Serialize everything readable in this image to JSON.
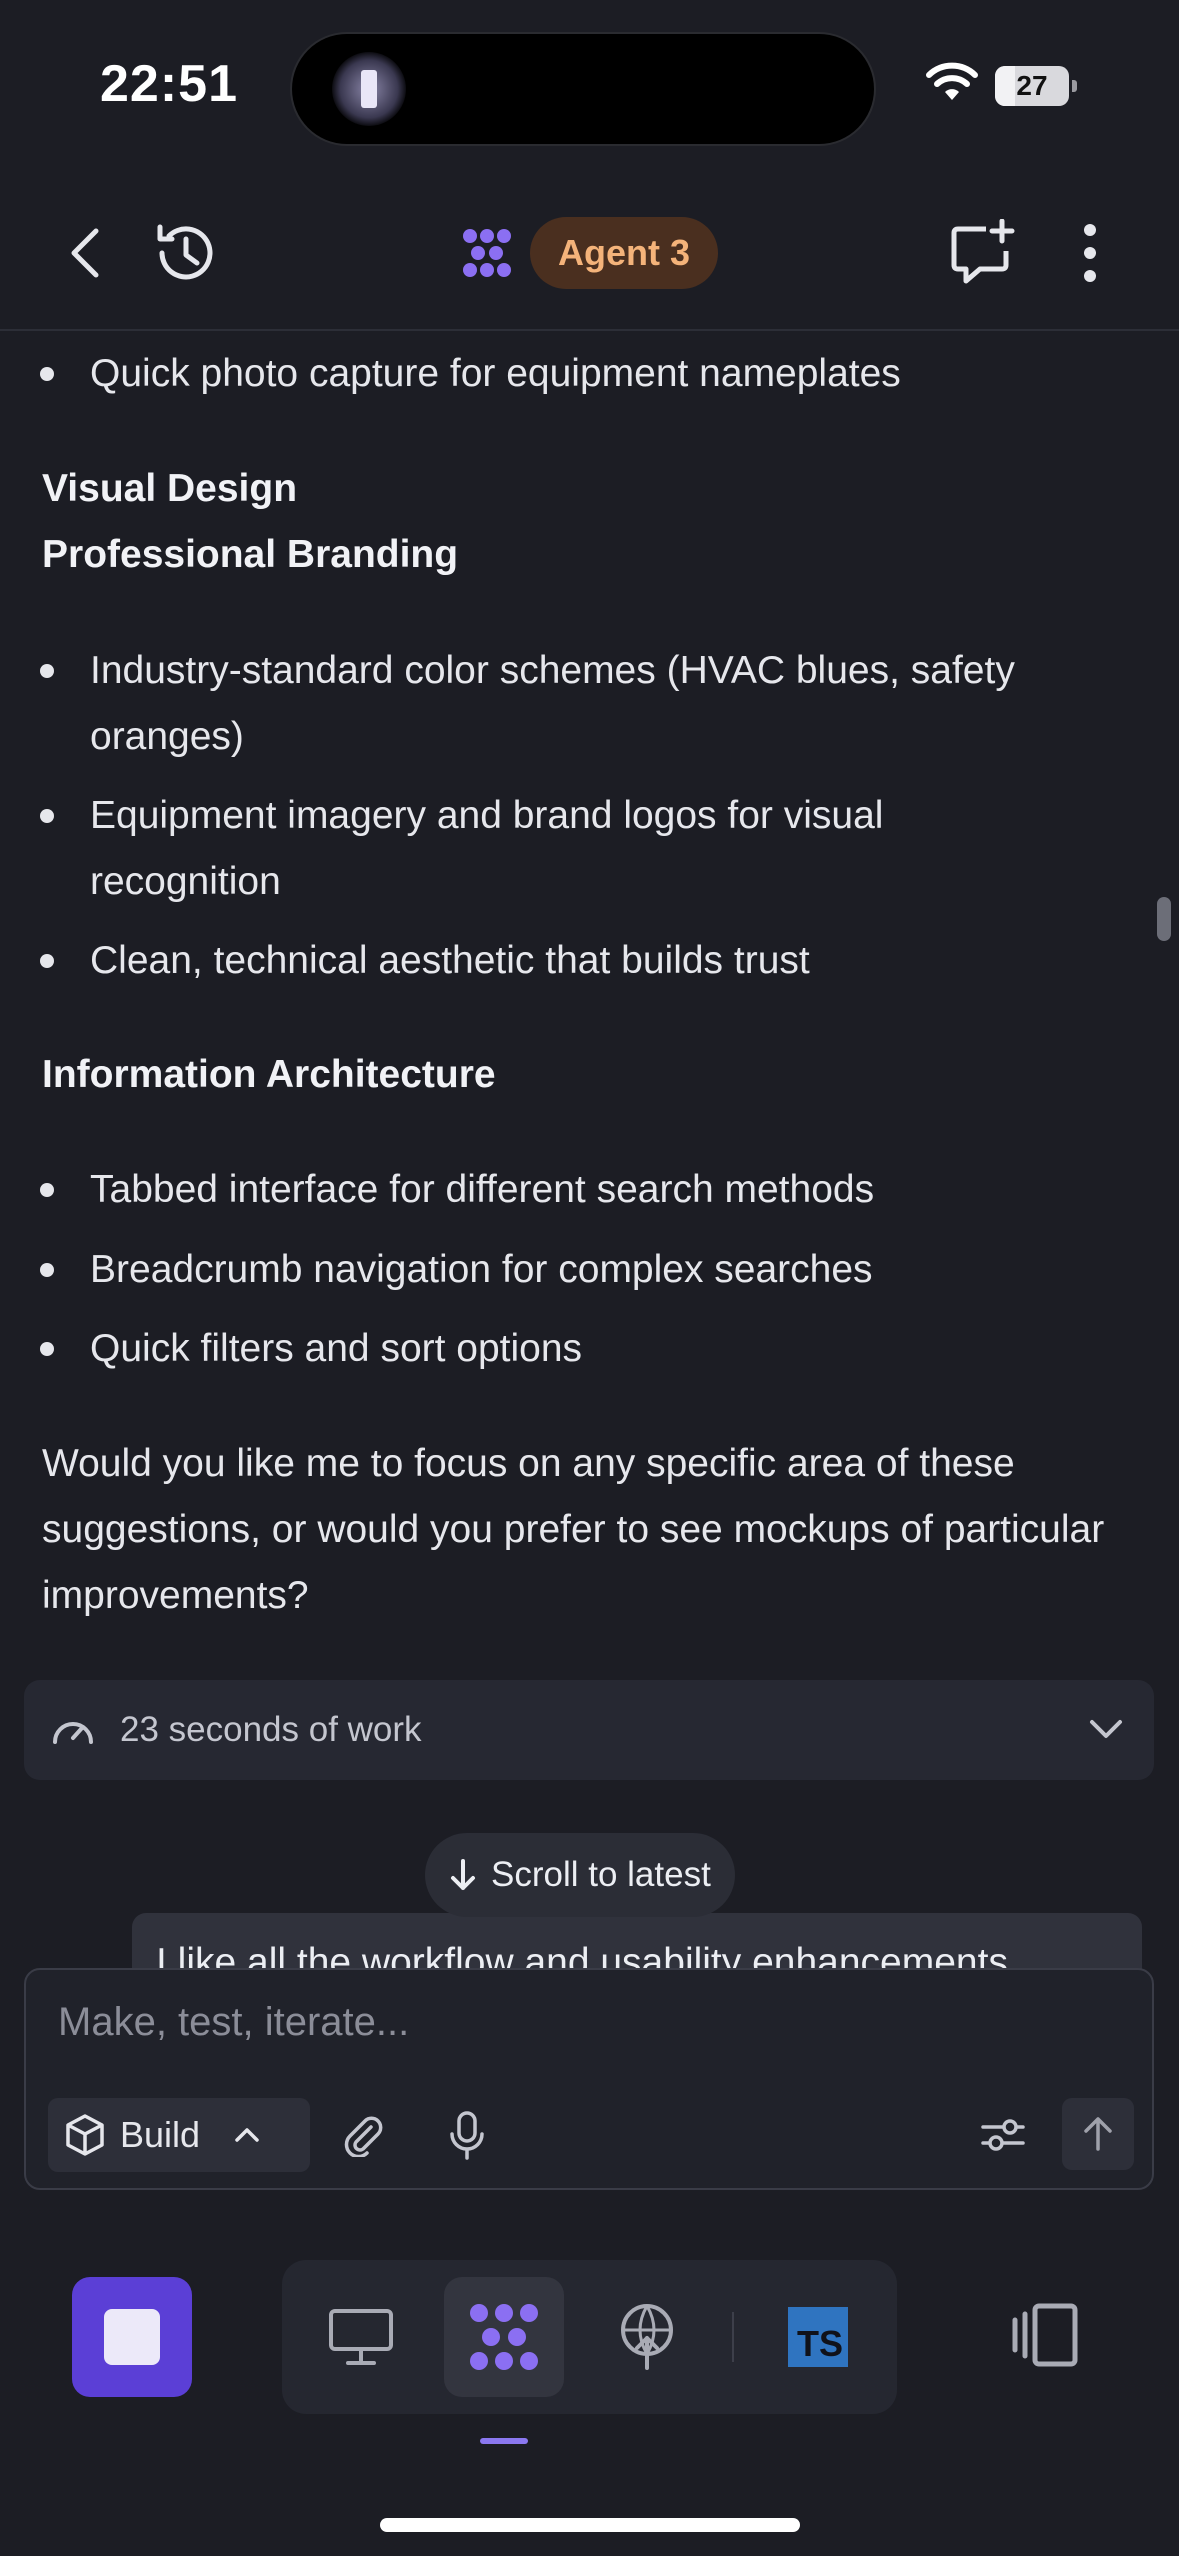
{
  "status_bar": {
    "time": "22:51",
    "battery": "27"
  },
  "header": {
    "agent_label": "Agent 3"
  },
  "content": {
    "items_top": [
      "Quick photo capture for equipment nameplates"
    ],
    "heading_visual": "Visual Design",
    "heading_branding": "Professional Branding",
    "branding_items": [
      "Industry-standard color schemes (HVAC blues, safety oranges)",
      "Equipment imagery and brand logos for visual recognition",
      "Clean, technical aesthetic that builds trust"
    ],
    "heading_info": "Information Architecture",
    "info_items": [
      "Tabbed interface for different search methods",
      "Breadcrumb navigation for complex searches",
      "Quick filters and sort options"
    ],
    "closing_paragraph": "Would you like me to focus on any specific area of these suggestions, or would you prefer to see mockups of particular improvements?"
  },
  "work_summary": {
    "label": "23 seconds of work"
  },
  "scroll_latest": {
    "label": "Scroll to latest"
  },
  "previous_message": {
    "text": "I like all the workflow and usability enhancements"
  },
  "composer": {
    "placeholder": "Make, test, iterate...",
    "mode_label": "Build"
  },
  "bottom_bar": {
    "ts_label": "TS"
  },
  "colors": {
    "background": "#1c1d24",
    "accent": "#5b3fd6",
    "agent_badge_bg": "#4a2f1f",
    "agent_badge_text": "#f4b37a"
  },
  "icons": [
    "back-icon",
    "history-icon",
    "agent-logo-icon",
    "new-chat-icon",
    "more-icon",
    "gauge-icon",
    "chevron-down-icon",
    "arrow-down-icon",
    "cube-icon",
    "chevron-up-icon",
    "paperclip-icon",
    "microphone-icon",
    "sliders-icon",
    "arrow-up-icon",
    "stop-icon",
    "monitor-icon",
    "agent-icon",
    "deploy-icon",
    "typescript-icon",
    "panel-icon"
  ]
}
